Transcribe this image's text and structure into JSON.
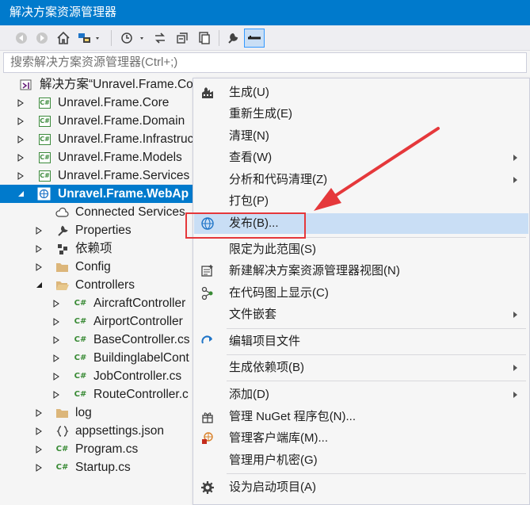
{
  "window": {
    "title": "解决方案资源管理器"
  },
  "toolbar": {
    "buttons": [
      "back-icon",
      "forward-icon",
      "home-icon",
      "switch-views-icon",
      "history-icon",
      "sync-icon",
      "collapse-all-icon",
      "copy-icon",
      "properties-wrench-icon",
      "preview-icon"
    ]
  },
  "search": {
    "placeholder": "搜索解决方案资源管理器(Ctrl+;)"
  },
  "tree": {
    "solution": "解决方案“Unravel.Frame.Co",
    "projects": [
      "Unravel.Frame.Core",
      "Unravel.Frame.Domain",
      "Unravel.Frame.Infrastruc",
      "Unravel.Frame.Models",
      "Unravel.Frame.Services"
    ],
    "webapi": "Unravel.Frame.WebAp",
    "webapi_children": {
      "connected": "Connected Services",
      "properties": "Properties",
      "deps": "依赖项",
      "config": "Config",
      "controllers": "Controllers"
    },
    "controllers": [
      "AircraftController",
      "AirportController",
      "BaseController.cs",
      "BuildinglabelCont",
      "JobController.cs",
      "RouteController.c"
    ],
    "tail": [
      "log",
      "appsettings.json",
      "Program.cs",
      "Startup.cs"
    ]
  },
  "menu": {
    "items": [
      {
        "label": "生成(U)",
        "icon": "build-icon"
      },
      {
        "label": "重新生成(E)"
      },
      {
        "label": "清理(N)"
      },
      {
        "label": "查看(W)",
        "submenu": true
      },
      {
        "label": "分析和代码清理(Z)",
        "submenu": true
      },
      {
        "label": "打包(P)"
      },
      {
        "label": "发布(B)...",
        "icon": "publish-globe-icon",
        "highlighted": true
      },
      {
        "label": "限定为此范围(S)"
      },
      {
        "label": "新建解决方案资源管理器视图(N)",
        "icon": "new-view-icon"
      },
      {
        "label": "在代码图上显示(C)",
        "icon": "code-map-icon"
      },
      {
        "label": "文件嵌套",
        "submenu": true
      },
      {
        "label": "编辑项目文件",
        "icon": "edit-project-icon"
      },
      {
        "label": "生成依赖项(B)",
        "submenu": true
      },
      {
        "label": "添加(D)",
        "submenu": true
      },
      {
        "label": "管理 NuGet 程序包(N)...",
        "icon": "nuget-icon"
      },
      {
        "label": "管理客户端库(M)...",
        "icon": "client-library-icon"
      },
      {
        "label": "管理用户机密(G)"
      },
      {
        "label": "设为启动项目(A)",
        "icon": "gear-icon"
      }
    ]
  },
  "colors": {
    "accent": "#007acc",
    "highlight": "#c9def5",
    "annotation": "#e5383b"
  }
}
